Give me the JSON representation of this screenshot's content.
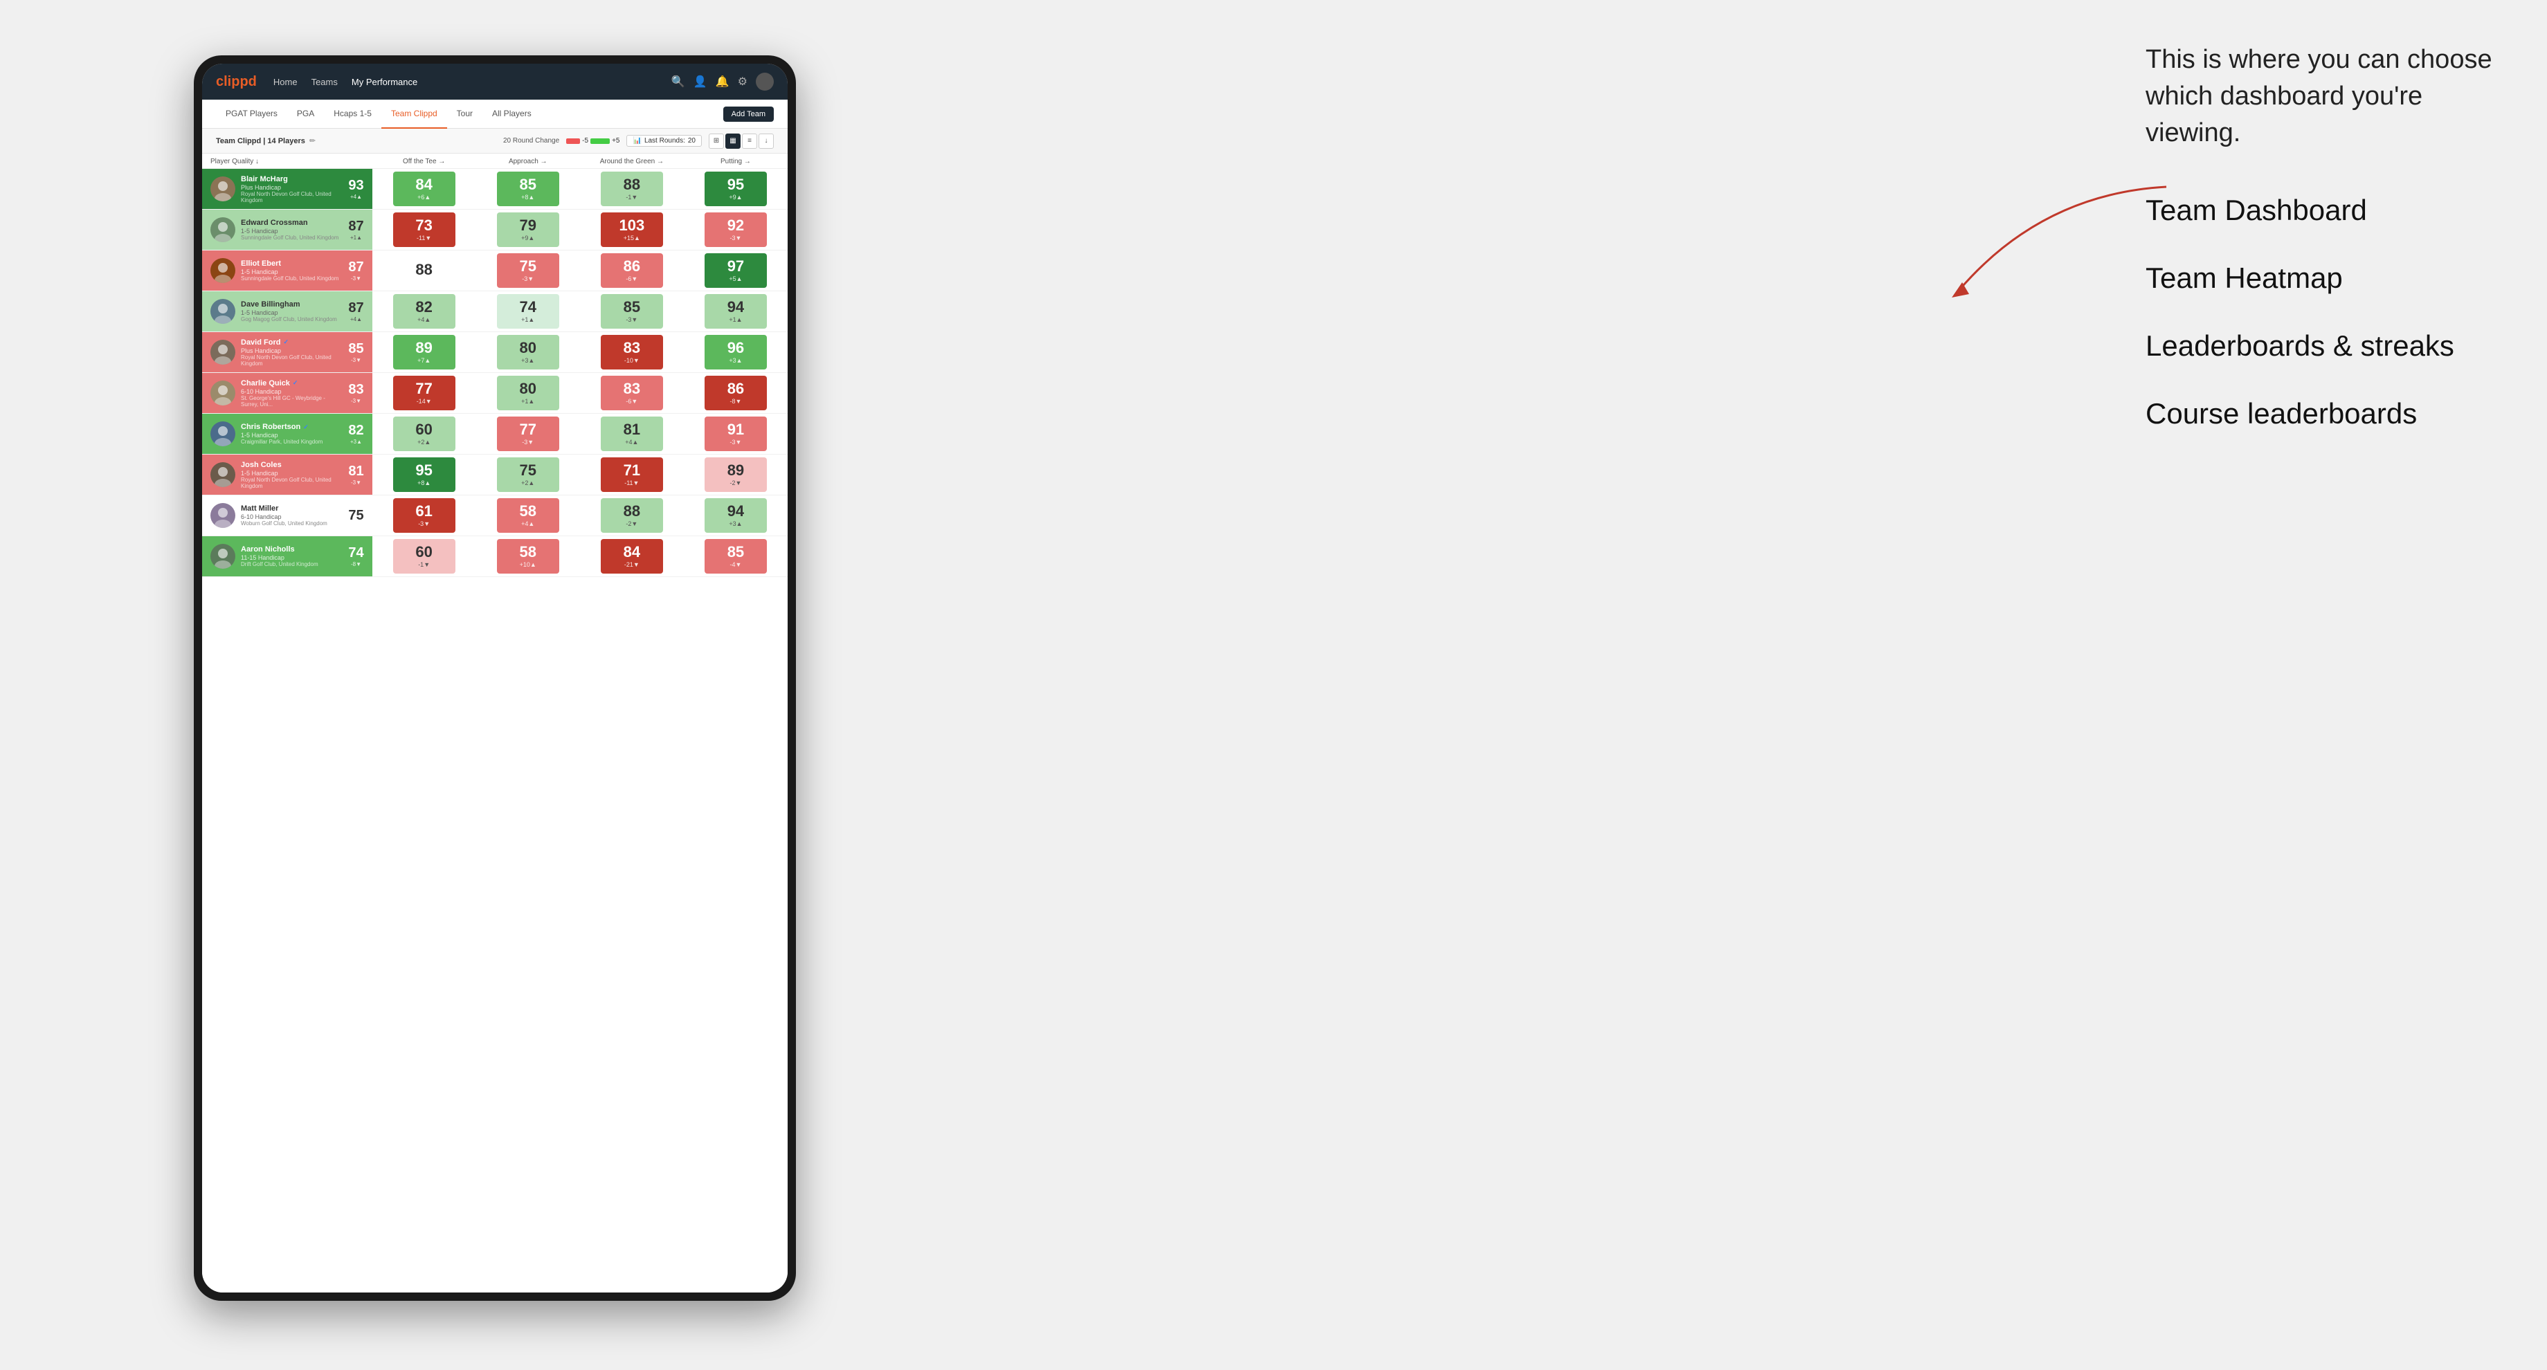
{
  "annotation": {
    "intro_text": "This is where you can choose which dashboard you're viewing.",
    "items": [
      "Team Dashboard",
      "Team Heatmap",
      "Leaderboards & streaks",
      "Course leaderboards"
    ]
  },
  "nav": {
    "logo": "clippd",
    "links": [
      "Home",
      "Teams",
      "My Performance"
    ],
    "active_link": "My Performance"
  },
  "sub_nav": {
    "links": [
      "PGAT Players",
      "PGA",
      "Hcaps 1-5",
      "Team Clippd",
      "Tour",
      "All Players"
    ],
    "active_link": "Team Clippd",
    "add_team_label": "Add Team"
  },
  "team_header": {
    "team_name": "Team Clippd",
    "player_count": "14 Players",
    "round_change_label": "20 Round Change",
    "change_minus": "-5",
    "change_plus": "+5",
    "last_rounds_label": "Last Rounds:",
    "last_rounds_value": "20"
  },
  "table": {
    "columns": [
      "Player Quality ↓",
      "Off the Tee →",
      "Approach →",
      "Around the Green →",
      "Putting →"
    ],
    "players": [
      {
        "name": "Blair McHarg",
        "handicap": "Plus Handicap",
        "club": "Royal North Devon Golf Club, United Kingdom",
        "avatar_color": "#8B7355",
        "stats": [
          {
            "value": 93,
            "change": "+4",
            "dir": "up",
            "bg": "dark-green"
          },
          {
            "value": 84,
            "change": "+6",
            "dir": "up",
            "bg": "medium-green"
          },
          {
            "value": 85,
            "change": "+8",
            "dir": "up",
            "bg": "medium-green"
          },
          {
            "value": 88,
            "change": "-1",
            "dir": "down",
            "bg": "light-green"
          },
          {
            "value": 95,
            "change": "+9",
            "dir": "up",
            "bg": "dark-green"
          }
        ]
      },
      {
        "name": "Edward Crossman",
        "handicap": "1-5 Handicap",
        "club": "Sunningdale Golf Club, United Kingdom",
        "avatar_color": "#6B8E6B",
        "stats": [
          {
            "value": 87,
            "change": "+1",
            "dir": "up",
            "bg": "light-green"
          },
          {
            "value": 73,
            "change": "-11",
            "dir": "down",
            "bg": "dark-red"
          },
          {
            "value": 79,
            "change": "+9",
            "dir": "up",
            "bg": "light-green"
          },
          {
            "value": 103,
            "change": "+15",
            "dir": "up",
            "bg": "dark-red"
          },
          {
            "value": 92,
            "change": "-3",
            "dir": "down",
            "bg": "medium-red"
          }
        ]
      },
      {
        "name": "Elliot Ebert",
        "handicap": "1-5 Handicap",
        "club": "Sunningdale Golf Club, United Kingdom",
        "avatar_color": "#8B4513",
        "stats": [
          {
            "value": 87,
            "change": "-3",
            "dir": "down",
            "bg": "medium-red"
          },
          {
            "value": 88,
            "change": "",
            "dir": "",
            "bg": "white"
          },
          {
            "value": 75,
            "change": "-3",
            "dir": "down",
            "bg": "medium-red"
          },
          {
            "value": 86,
            "change": "-6",
            "dir": "down",
            "bg": "medium-red"
          },
          {
            "value": 97,
            "change": "+5",
            "dir": "up",
            "bg": "dark-green"
          }
        ]
      },
      {
        "name": "Dave Billingham",
        "handicap": "1-5 Handicap",
        "club": "Gog Magog Golf Club, United Kingdom",
        "avatar_color": "#5B7B8B",
        "stats": [
          {
            "value": 87,
            "change": "+4",
            "dir": "up",
            "bg": "light-green"
          },
          {
            "value": 82,
            "change": "+4",
            "dir": "up",
            "bg": "light-green"
          },
          {
            "value": 74,
            "change": "+1",
            "dir": "up",
            "bg": "very-light-green"
          },
          {
            "value": 85,
            "change": "-3",
            "dir": "down",
            "bg": "light-green"
          },
          {
            "value": 94,
            "change": "+1",
            "dir": "up",
            "bg": "light-green"
          }
        ]
      },
      {
        "name": "David Ford",
        "handicap": "Plus Handicap",
        "club": "Royal North Devon Golf Club, United Kingdom",
        "avatar_color": "#7B6B5B",
        "verified": true,
        "stats": [
          {
            "value": 85,
            "change": "-3",
            "dir": "down",
            "bg": "medium-red"
          },
          {
            "value": 89,
            "change": "+7",
            "dir": "up",
            "bg": "medium-green"
          },
          {
            "value": 80,
            "change": "+3",
            "dir": "up",
            "bg": "light-green"
          },
          {
            "value": 83,
            "change": "-10",
            "dir": "down",
            "bg": "dark-red"
          },
          {
            "value": 96,
            "change": "+3",
            "dir": "up",
            "bg": "medium-green"
          }
        ]
      },
      {
        "name": "Charlie Quick",
        "handicap": "6-10 Handicap",
        "club": "St. George's Hill GC - Weybridge - Surrey, Uni...",
        "avatar_color": "#9B8B6B",
        "verified": true,
        "stats": [
          {
            "value": 83,
            "change": "-3",
            "dir": "down",
            "bg": "medium-red"
          },
          {
            "value": 77,
            "change": "-14",
            "dir": "down",
            "bg": "dark-red"
          },
          {
            "value": 80,
            "change": "+1",
            "dir": "up",
            "bg": "light-green"
          },
          {
            "value": 83,
            "change": "-6",
            "dir": "down",
            "bg": "medium-red"
          },
          {
            "value": 86,
            "change": "-8",
            "dir": "down",
            "bg": "dark-red"
          }
        ]
      },
      {
        "name": "Chris Robertson",
        "handicap": "1-5 Handicap",
        "club": "Craigmillar Park, United Kingdom",
        "avatar_color": "#4B6B8B",
        "verified": true,
        "stats": [
          {
            "value": 82,
            "change": "+3",
            "dir": "up",
            "bg": "medium-green"
          },
          {
            "value": 60,
            "change": "+2",
            "dir": "up",
            "bg": "light-green"
          },
          {
            "value": 77,
            "change": "-3",
            "dir": "down",
            "bg": "medium-red"
          },
          {
            "value": 81,
            "change": "+4",
            "dir": "up",
            "bg": "light-green"
          },
          {
            "value": 91,
            "change": "-3",
            "dir": "down",
            "bg": "medium-red"
          }
        ]
      },
      {
        "name": "Josh Coles",
        "handicap": "1-5 Handicap",
        "club": "Royal North Devon Golf Club, United Kingdom",
        "avatar_color": "#6B5B4B",
        "stats": [
          {
            "value": 81,
            "change": "-3",
            "dir": "down",
            "bg": "medium-red"
          },
          {
            "value": 95,
            "change": "+8",
            "dir": "up",
            "bg": "dark-green"
          },
          {
            "value": 75,
            "change": "+2",
            "dir": "up",
            "bg": "light-green"
          },
          {
            "value": 71,
            "change": "-11",
            "dir": "down",
            "bg": "dark-red"
          },
          {
            "value": 89,
            "change": "-2",
            "dir": "down",
            "bg": "light-red"
          }
        ]
      },
      {
        "name": "Matt Miller",
        "handicap": "6-10 Handicap",
        "club": "Woburn Golf Club, United Kingdom",
        "avatar_color": "#8B7B9B",
        "stats": [
          {
            "value": 75,
            "change": "",
            "dir": "",
            "bg": "white"
          },
          {
            "value": 61,
            "change": "-3",
            "dir": "down",
            "bg": "dark-red"
          },
          {
            "value": 58,
            "change": "+4",
            "dir": "up",
            "bg": "medium-red"
          },
          {
            "value": 88,
            "change": "-2",
            "dir": "down",
            "bg": "light-green"
          },
          {
            "value": 94,
            "change": "+3",
            "dir": "up",
            "bg": "light-green"
          }
        ]
      },
      {
        "name": "Aaron Nicholls",
        "handicap": "11-15 Handicap",
        "club": "Drift Golf Club, United Kingdom",
        "avatar_color": "#5B7B5B",
        "stats": [
          {
            "value": 74,
            "change": "-8",
            "dir": "down",
            "bg": "medium-green"
          },
          {
            "value": 60,
            "change": "-1",
            "dir": "down",
            "bg": "light-red"
          },
          {
            "value": 58,
            "change": "+10",
            "dir": "up",
            "bg": "medium-red"
          },
          {
            "value": 84,
            "change": "-21",
            "dir": "down",
            "bg": "dark-red"
          },
          {
            "value": 85,
            "change": "-4",
            "dir": "down",
            "bg": "medium-red"
          }
        ]
      }
    ]
  }
}
